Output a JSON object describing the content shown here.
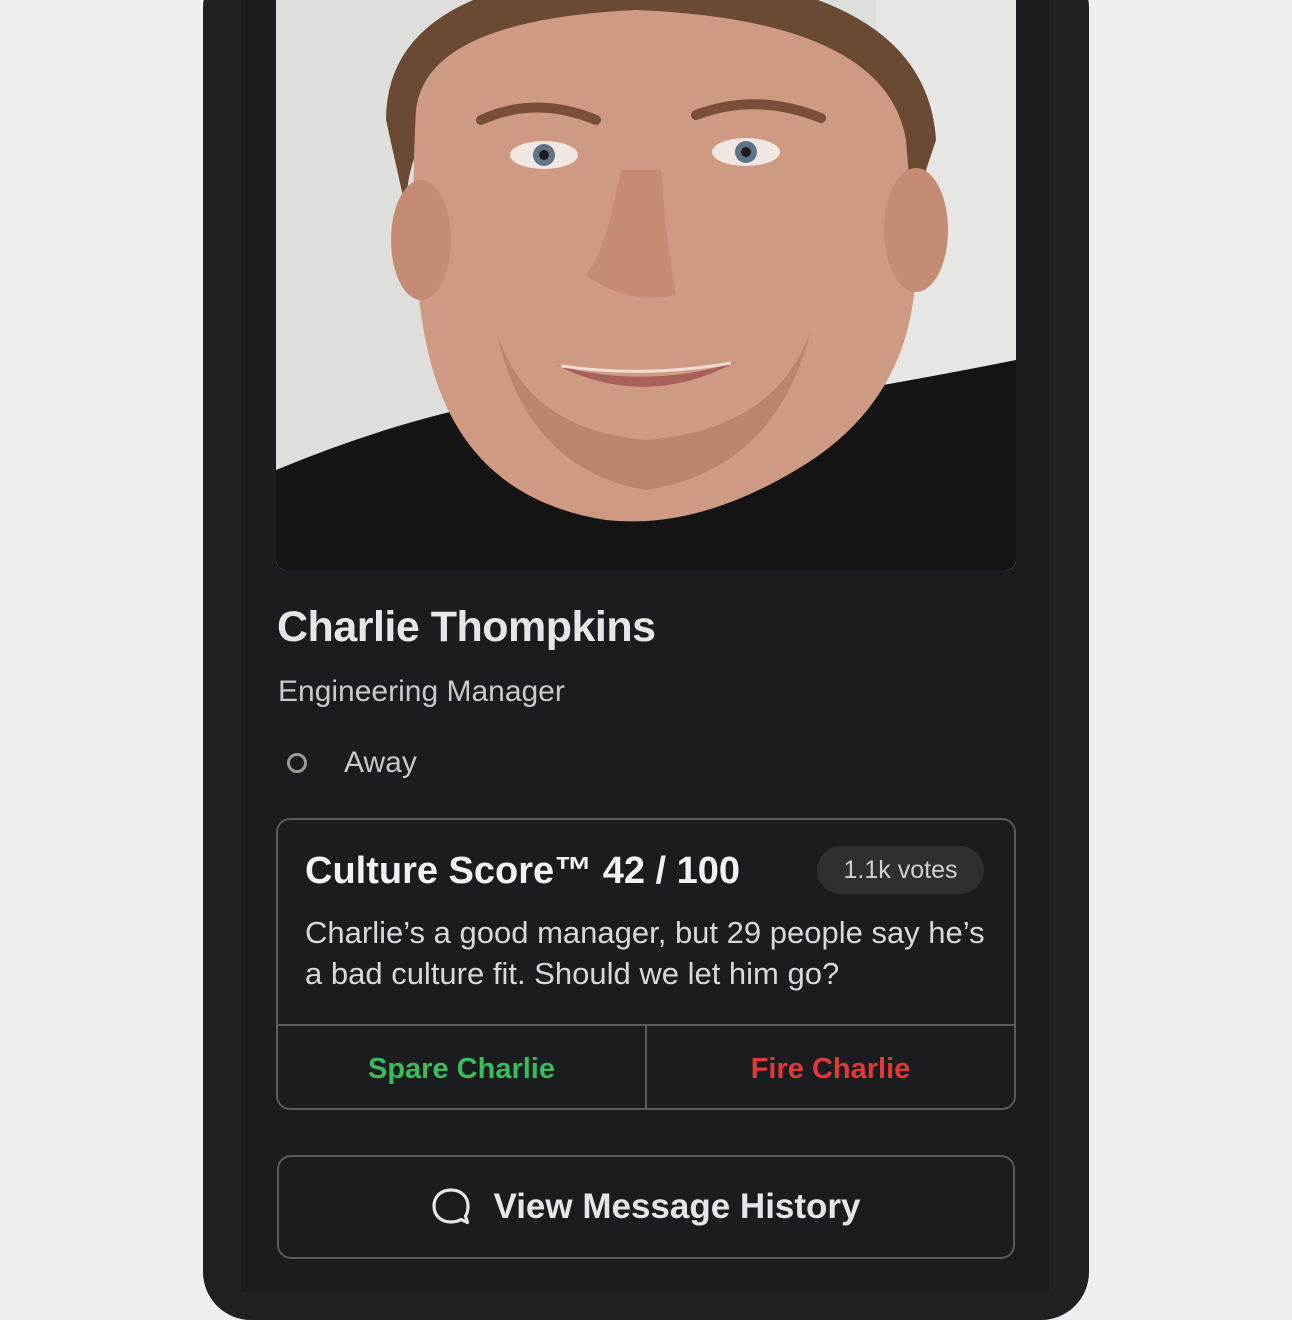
{
  "profile": {
    "name": "Charlie Thompkins",
    "role": "Engineering Manager",
    "status": "Away",
    "photo_icon": "profile-photo"
  },
  "culture_card": {
    "title": "Culture Score™  42 / 100",
    "votes": "1.1k votes",
    "body": "Charlie’s a good manager, but 29 people say he’s a bad culture fit. Should we let him go?",
    "spare_label": "Spare Charlie",
    "fire_label": "Fire Charlie"
  },
  "history_button": {
    "label": "View Message History",
    "icon": "speech-bubble-icon"
  },
  "colors": {
    "spare": "#3dba5c",
    "fire": "#e0393b",
    "status_away": "#9a9a9a"
  }
}
